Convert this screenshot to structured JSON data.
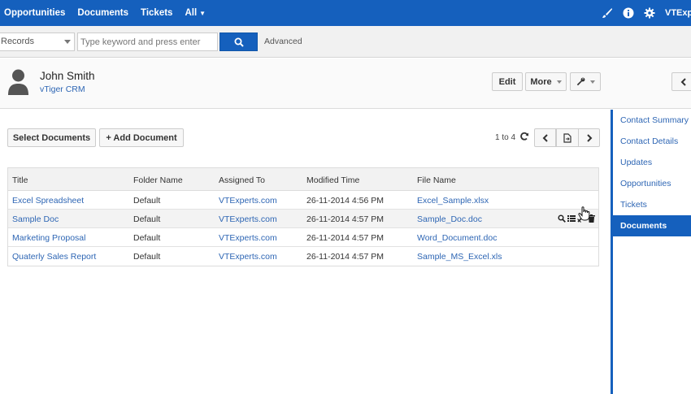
{
  "topnav": {
    "items": [
      {
        "label": "Opportunities"
      },
      {
        "label": "Documents"
      },
      {
        "label": "Tickets"
      },
      {
        "label": "All"
      }
    ],
    "user_label": "VTExperts"
  },
  "search": {
    "records_select": "Records",
    "placeholder": "Type keyword and press enter",
    "advanced_label": "Advanced"
  },
  "contact": {
    "name": "John Smith",
    "organization": "vTiger CRM"
  },
  "header_buttons": {
    "edit": "Edit",
    "more": "More"
  },
  "documents": {
    "select_label": "Select Documents",
    "add_label": "+ Add Document",
    "pager_text": "1 to 4",
    "columns": [
      "Title",
      "Folder Name",
      "Assigned To",
      "Modified Time",
      "File Name"
    ],
    "rows": [
      {
        "title": "Excel Spreadsheet",
        "folder": "Default",
        "assigned": "VTExperts.com",
        "modified": "26-11-2014 4:56 PM",
        "file": "Excel_Sample.xlsx"
      },
      {
        "title": "Sample Doc",
        "folder": "Default",
        "assigned": "VTExperts.com",
        "modified": "26-11-2014 4:57 PM",
        "file": "Sample_Doc.doc"
      },
      {
        "title": "Marketing Proposal",
        "folder": "Default",
        "assigned": "VTExperts.com",
        "modified": "26-11-2014 4:57 PM",
        "file": "Word_Document.doc"
      },
      {
        "title": "Quaterly Sales Report",
        "folder": "Default",
        "assigned": "VTExperts.com",
        "modified": "26-11-2014 4:57 PM",
        "file": "Sample_MS_Excel.xls"
      }
    ]
  },
  "sidebar": {
    "items": [
      {
        "label": "Contact Summary"
      },
      {
        "label": "Contact Details"
      },
      {
        "label": "Updates"
      },
      {
        "label": "Opportunities"
      },
      {
        "label": "Tickets"
      },
      {
        "label": "Documents",
        "active": true
      }
    ]
  },
  "colors": {
    "brand_blue": "#1560bd",
    "link_blue": "#2e66b4"
  }
}
